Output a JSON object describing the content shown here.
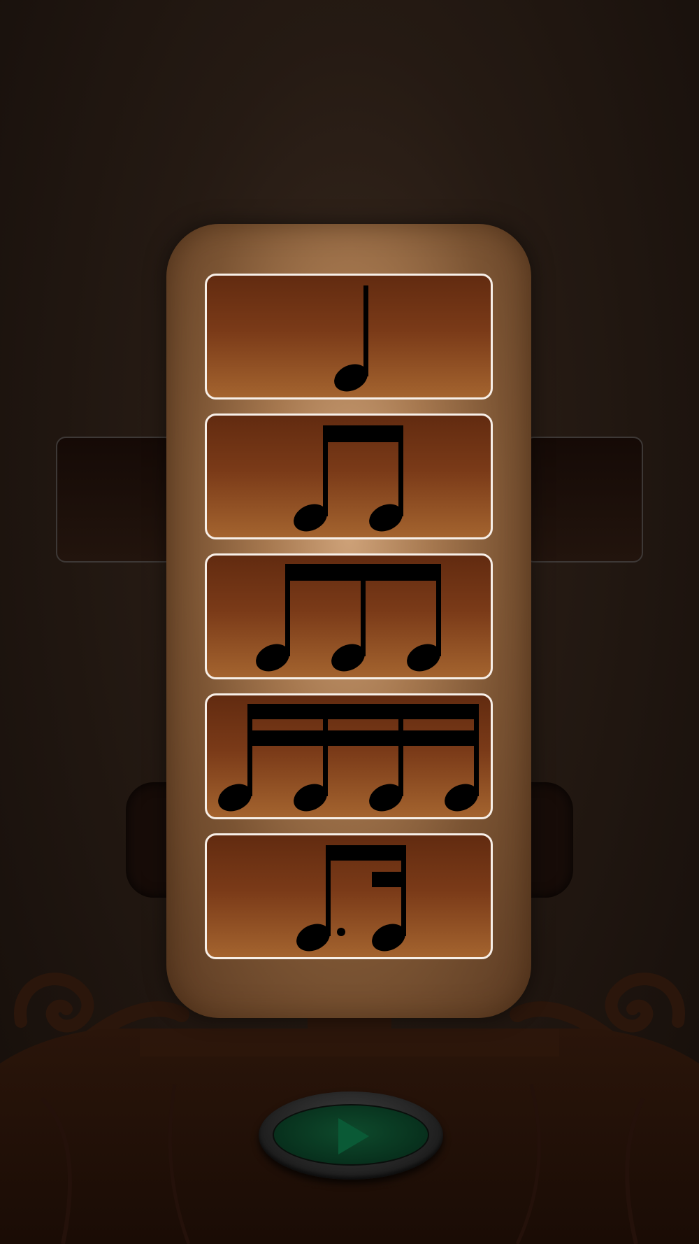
{
  "screen": {
    "title": "",
    "background_color": "#1f150f",
    "accent_color": "#a4642f"
  },
  "rhythm_options": [
    {
      "name": "quarter-note",
      "icon": "quarter-note-icon"
    },
    {
      "name": "eighth-note-pair",
      "icon": "eighth-note-pair-icon"
    },
    {
      "name": "eighth-note-triplet",
      "icon": "eighth-note-triplet-icon"
    },
    {
      "name": "sixteenth-note-group",
      "icon": "sixteenth-note-group-icon"
    },
    {
      "name": "dotted-eighth-sixteenth",
      "icon": "dotted-eighth-sixteenth-icon"
    }
  ],
  "play_button": {
    "icon": "play-icon",
    "color": "#0e4a2c"
  }
}
